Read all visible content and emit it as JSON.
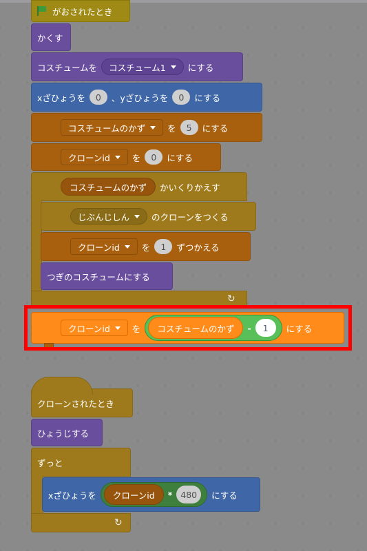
{
  "script1": {
    "hat_label": "がおされたとき",
    "hide_label": "かくす",
    "switch_costume": {
      "prefix": "コスチュームを",
      "value": "コスチューム1",
      "suffix": "にする"
    },
    "goto_xy": {
      "x_label": "xざひょうを",
      "x": "0",
      "sep": "、yざひょうを",
      "y": "0",
      "suffix": "にする"
    },
    "set_costume_count": {
      "var": "コスチュームのかず",
      "mid": "を",
      "value": "5",
      "suffix": "にする"
    },
    "set_clone_id": {
      "var": "クローンid",
      "mid": "を",
      "value": "0",
      "suffix": "にする"
    },
    "repeat": {
      "reporter": "コスチュームのかず",
      "suffix": "かいくりかえす"
    },
    "create_clone": {
      "target": "じぶんじしん",
      "suffix": "のクローンをつくる"
    },
    "change_clone_id": {
      "var": "クローンid",
      "mid": "を",
      "value": "1",
      "suffix": "ずつかえる"
    },
    "next_costume_label": "つぎのコスチュームにする",
    "repeat_arrow": "↻"
  },
  "highlighted": {
    "var": "クローンid",
    "mid": "を",
    "reporter": "コスチュームのかず",
    "op": "-",
    "value": "1",
    "suffix": "にする",
    "highlight_color": "#ff0000"
  },
  "script2": {
    "hat_label": "クローンされたとき",
    "show_label": "ひょうじする",
    "forever_label": "ずっと",
    "set_x": {
      "prefix": "xざひょうを",
      "reporter": "クローンid",
      "op": "*",
      "value": "480",
      "suffix": "にする"
    },
    "forever_arrow": "↻"
  },
  "colors": {
    "workspace": "#8a8a8a",
    "events": "#9e8a14",
    "looks": "#6a4e9e",
    "motion": "#3f66a6",
    "variables": "#a9600e",
    "control": "#9e7a1d",
    "variables_active": "#ff8c1a",
    "operators_active": "#59c059"
  }
}
